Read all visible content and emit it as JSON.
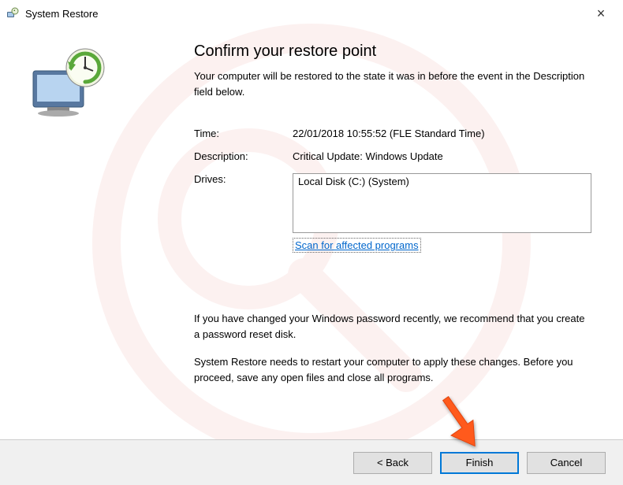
{
  "window": {
    "title": "System Restore",
    "close_label": "×"
  },
  "main": {
    "heading": "Confirm your restore point",
    "subtext": "Your computer will be restored to the state it was in before the event in the Description field below.",
    "time_label": "Time:",
    "time_value": "22/01/2018 10:55:52 (FLE Standard Time)",
    "description_label": "Description:",
    "description_value": "Critical Update: Windows Update",
    "drives_label": "Drives:",
    "drives_value": "Local Disk (C:) (System)",
    "scan_link": "Scan for affected programs",
    "password_note": "If you have changed your Windows password recently, we recommend that you create a password reset disk.",
    "restart_note": "System Restore needs to restart your computer to apply these changes. Before you proceed, save any open files and close all programs."
  },
  "footer": {
    "back_label": "< Back",
    "finish_label": "Finish",
    "cancel_label": "Cancel"
  }
}
